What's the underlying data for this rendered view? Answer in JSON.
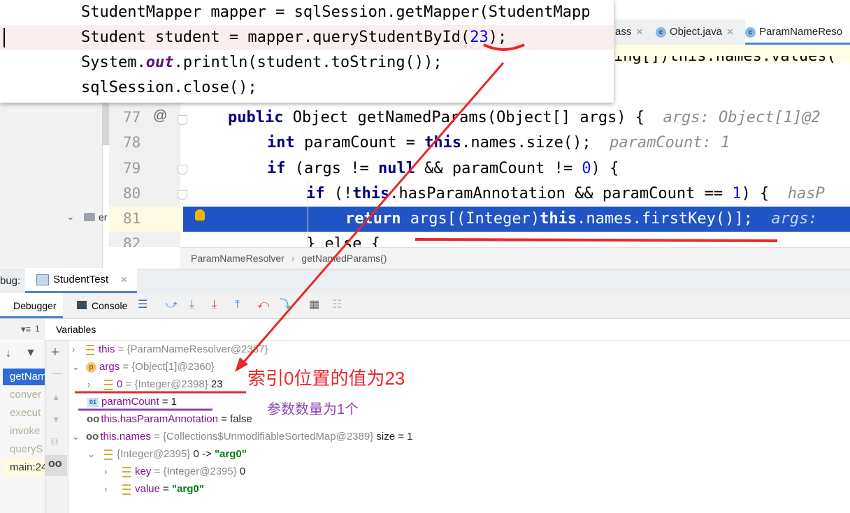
{
  "popup": {
    "line1": "StudentMapper mapper = sqlSession.getMapper(StudentMapp",
    "line2_a": "Student student = mapper.queryStudentById(",
    "line2_num": "23",
    "line2_b": ");",
    "line3_a": "System.",
    "line3_field": "out",
    "line3_b": ".println(student.toString());",
    "line4": "sqlSession.close();"
  },
  "tabs": [
    {
      "label": "ass"
    },
    {
      "label": "Object.java"
    },
    {
      "label": "ParamNameReso"
    }
  ],
  "editor": {
    "partial_line": "ing[])this.names.values(",
    "line_numbers": [
      "77",
      "78",
      "79",
      "80",
      "81",
      "82"
    ],
    "l77_kw": "public",
    "l77_b": " Object getNamedParams(Object[] args) {",
    "l77_hint": "args: Object[1]@2",
    "l78_kw": "int",
    "l78_b": " paramCount = ",
    "l78_kw2": "this",
    "l78_c": ".names.size();",
    "l78_hint": "paramCount: 1",
    "l79_kw": "if",
    "l79_b": " (args != ",
    "l79_kw2": "null",
    "l79_c": " && paramCount != ",
    "l79_num": "0",
    "l79_d": ") {",
    "l80_kw": "if",
    "l80_b": " (!",
    "l80_kw2": "this",
    "l80_c": ".hasParamAnnotation && paramCount == ",
    "l80_num": "1",
    "l80_d": ") {",
    "l80_hint": "hasP",
    "l81_kw": "return",
    "l81_b": " args[(Integer)",
    "l81_kw2": "this",
    "l81_c": ".names.firstKey()];",
    "l81_hint": "args:",
    "l82": "} else {"
  },
  "breadcrumb": {
    "class": "ParamNameResolver",
    "sep": "›",
    "method": "getNamedParams()"
  },
  "debug": {
    "label": "bug:",
    "run_tab": "StudentTest",
    "debugger_tab": "Debugger",
    "console_tab": "Console",
    "variables_header": "Variables",
    "frames_counter": "1"
  },
  "frames": [
    "getNam",
    "conver",
    "execut",
    "invoke",
    "queryS",
    "main:24"
  ],
  "variables": {
    "this_name": "this",
    "this_val": " = {ParamNameResolver@2387}",
    "args_name": "args",
    "args_val": " = {Object[1]@2360}",
    "zero_name": "0",
    "zero_val": " = {Integer@2398}",
    "zero_num": " 23",
    "pc_name": "paramCount",
    "pc_val": " = 1",
    "hpa_name": "this.hasParamAnnotation",
    "hpa_val": " = false",
    "names_name": "this.names",
    "names_val": " = {Collections$UnmodifiableSortedMap@2389}",
    "names_size": "  size = 1",
    "entry_a": "{Integer@2395}",
    "entry_b": " 0 -> ",
    "entry_str": "\"arg0\"",
    "key_name": "key",
    "key_val": " = {Integer@2395}",
    "key_num": " 0",
    "value_name": "value",
    "value_val": " = ",
    "value_str": "\"arg0\""
  },
  "annotations": {
    "red_note": "索引0位置的值为23",
    "purple_note": "参数数量为1个",
    "red_color": "#e8282b",
    "purple_color": "#8e44ad"
  }
}
